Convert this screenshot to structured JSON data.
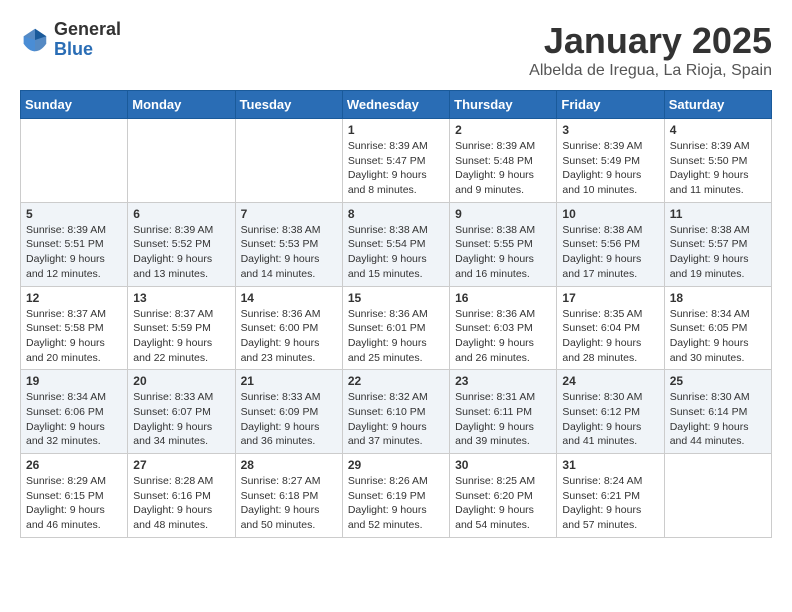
{
  "logo": {
    "general": "General",
    "blue": "Blue"
  },
  "title": "January 2025",
  "location": "Albelda de Iregua, La Rioja, Spain",
  "weekdays": [
    "Sunday",
    "Monday",
    "Tuesday",
    "Wednesday",
    "Thursday",
    "Friday",
    "Saturday"
  ],
  "weeks": [
    [
      {
        "day": "",
        "sunrise": "",
        "sunset": "",
        "daylight": ""
      },
      {
        "day": "",
        "sunrise": "",
        "sunset": "",
        "daylight": ""
      },
      {
        "day": "",
        "sunrise": "",
        "sunset": "",
        "daylight": ""
      },
      {
        "day": "1",
        "sunrise": "Sunrise: 8:39 AM",
        "sunset": "Sunset: 5:47 PM",
        "daylight": "Daylight: 9 hours and 8 minutes."
      },
      {
        "day": "2",
        "sunrise": "Sunrise: 8:39 AM",
        "sunset": "Sunset: 5:48 PM",
        "daylight": "Daylight: 9 hours and 9 minutes."
      },
      {
        "day": "3",
        "sunrise": "Sunrise: 8:39 AM",
        "sunset": "Sunset: 5:49 PM",
        "daylight": "Daylight: 9 hours and 10 minutes."
      },
      {
        "day": "4",
        "sunrise": "Sunrise: 8:39 AM",
        "sunset": "Sunset: 5:50 PM",
        "daylight": "Daylight: 9 hours and 11 minutes."
      }
    ],
    [
      {
        "day": "5",
        "sunrise": "Sunrise: 8:39 AM",
        "sunset": "Sunset: 5:51 PM",
        "daylight": "Daylight: 9 hours and 12 minutes."
      },
      {
        "day": "6",
        "sunrise": "Sunrise: 8:39 AM",
        "sunset": "Sunset: 5:52 PM",
        "daylight": "Daylight: 9 hours and 13 minutes."
      },
      {
        "day": "7",
        "sunrise": "Sunrise: 8:38 AM",
        "sunset": "Sunset: 5:53 PM",
        "daylight": "Daylight: 9 hours and 14 minutes."
      },
      {
        "day": "8",
        "sunrise": "Sunrise: 8:38 AM",
        "sunset": "Sunset: 5:54 PM",
        "daylight": "Daylight: 9 hours and 15 minutes."
      },
      {
        "day": "9",
        "sunrise": "Sunrise: 8:38 AM",
        "sunset": "Sunset: 5:55 PM",
        "daylight": "Daylight: 9 hours and 16 minutes."
      },
      {
        "day": "10",
        "sunrise": "Sunrise: 8:38 AM",
        "sunset": "Sunset: 5:56 PM",
        "daylight": "Daylight: 9 hours and 17 minutes."
      },
      {
        "day": "11",
        "sunrise": "Sunrise: 8:38 AM",
        "sunset": "Sunset: 5:57 PM",
        "daylight": "Daylight: 9 hours and 19 minutes."
      }
    ],
    [
      {
        "day": "12",
        "sunrise": "Sunrise: 8:37 AM",
        "sunset": "Sunset: 5:58 PM",
        "daylight": "Daylight: 9 hours and 20 minutes."
      },
      {
        "day": "13",
        "sunrise": "Sunrise: 8:37 AM",
        "sunset": "Sunset: 5:59 PM",
        "daylight": "Daylight: 9 hours and 22 minutes."
      },
      {
        "day": "14",
        "sunrise": "Sunrise: 8:36 AM",
        "sunset": "Sunset: 6:00 PM",
        "daylight": "Daylight: 9 hours and 23 minutes."
      },
      {
        "day": "15",
        "sunrise": "Sunrise: 8:36 AM",
        "sunset": "Sunset: 6:01 PM",
        "daylight": "Daylight: 9 hours and 25 minutes."
      },
      {
        "day": "16",
        "sunrise": "Sunrise: 8:36 AM",
        "sunset": "Sunset: 6:03 PM",
        "daylight": "Daylight: 9 hours and 26 minutes."
      },
      {
        "day": "17",
        "sunrise": "Sunrise: 8:35 AM",
        "sunset": "Sunset: 6:04 PM",
        "daylight": "Daylight: 9 hours and 28 minutes."
      },
      {
        "day": "18",
        "sunrise": "Sunrise: 8:34 AM",
        "sunset": "Sunset: 6:05 PM",
        "daylight": "Daylight: 9 hours and 30 minutes."
      }
    ],
    [
      {
        "day": "19",
        "sunrise": "Sunrise: 8:34 AM",
        "sunset": "Sunset: 6:06 PM",
        "daylight": "Daylight: 9 hours and 32 minutes."
      },
      {
        "day": "20",
        "sunrise": "Sunrise: 8:33 AM",
        "sunset": "Sunset: 6:07 PM",
        "daylight": "Daylight: 9 hours and 34 minutes."
      },
      {
        "day": "21",
        "sunrise": "Sunrise: 8:33 AM",
        "sunset": "Sunset: 6:09 PM",
        "daylight": "Daylight: 9 hours and 36 minutes."
      },
      {
        "day": "22",
        "sunrise": "Sunrise: 8:32 AM",
        "sunset": "Sunset: 6:10 PM",
        "daylight": "Daylight: 9 hours and 37 minutes."
      },
      {
        "day": "23",
        "sunrise": "Sunrise: 8:31 AM",
        "sunset": "Sunset: 6:11 PM",
        "daylight": "Daylight: 9 hours and 39 minutes."
      },
      {
        "day": "24",
        "sunrise": "Sunrise: 8:30 AM",
        "sunset": "Sunset: 6:12 PM",
        "daylight": "Daylight: 9 hours and 41 minutes."
      },
      {
        "day": "25",
        "sunrise": "Sunrise: 8:30 AM",
        "sunset": "Sunset: 6:14 PM",
        "daylight": "Daylight: 9 hours and 44 minutes."
      }
    ],
    [
      {
        "day": "26",
        "sunrise": "Sunrise: 8:29 AM",
        "sunset": "Sunset: 6:15 PM",
        "daylight": "Daylight: 9 hours and 46 minutes."
      },
      {
        "day": "27",
        "sunrise": "Sunrise: 8:28 AM",
        "sunset": "Sunset: 6:16 PM",
        "daylight": "Daylight: 9 hours and 48 minutes."
      },
      {
        "day": "28",
        "sunrise": "Sunrise: 8:27 AM",
        "sunset": "Sunset: 6:18 PM",
        "daylight": "Daylight: 9 hours and 50 minutes."
      },
      {
        "day": "29",
        "sunrise": "Sunrise: 8:26 AM",
        "sunset": "Sunset: 6:19 PM",
        "daylight": "Daylight: 9 hours and 52 minutes."
      },
      {
        "day": "30",
        "sunrise": "Sunrise: 8:25 AM",
        "sunset": "Sunset: 6:20 PM",
        "daylight": "Daylight: 9 hours and 54 minutes."
      },
      {
        "day": "31",
        "sunrise": "Sunrise: 8:24 AM",
        "sunset": "Sunset: 6:21 PM",
        "daylight": "Daylight: 9 hours and 57 minutes."
      },
      {
        "day": "",
        "sunrise": "",
        "sunset": "",
        "daylight": ""
      }
    ]
  ]
}
